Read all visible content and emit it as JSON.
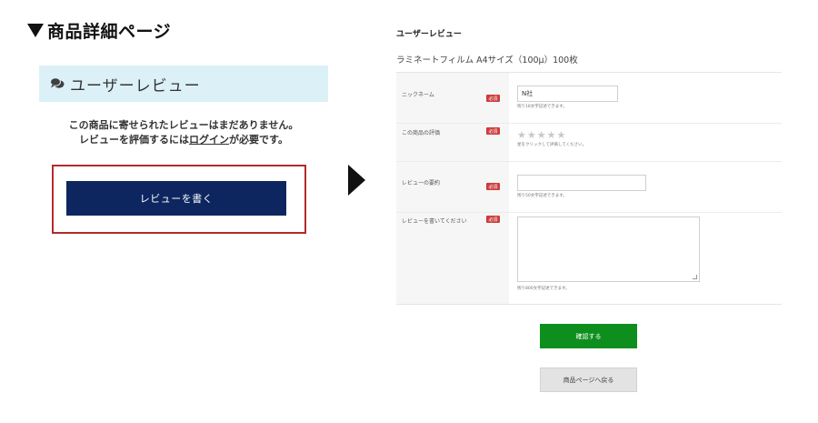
{
  "left_panel": {
    "heading": "商品詳細ページ",
    "review_section_title": "ユーザーレビュー",
    "no_review_line1": "この商品に寄せられたレビューはまだありません。",
    "no_review_line2_before": "レビューを評価するには",
    "login_link": "ログイン",
    "no_review_line2_after": "が必要です。",
    "write_review_button": "レビューを書く",
    "highlight_color": "#b42a2a",
    "button_color": "#0d2660"
  },
  "right_panel": {
    "title": "ユーザーレビュー",
    "product_name": "ラミネートフィルム A4サイズ（100μ）100枚",
    "required_badge": "必須",
    "fields": {
      "nickname": {
        "label": "ニックネーム",
        "value": "N社",
        "hint": "残り18文字記述できます。"
      },
      "rating": {
        "label": "この商品の評価",
        "hint": "星をクリックして評価してください。",
        "stars_total": 5,
        "stars_selected": 0
      },
      "summary": {
        "label": "レビューの要約",
        "value": "",
        "hint": "残り50文字記述できます。"
      },
      "body": {
        "label": "レビューを書いてください",
        "value": "",
        "hint": "残り800文字記述できます。"
      }
    },
    "confirm_button": "確認する",
    "back_button": "商品ページへ戻る",
    "required_color": "#cd3b3b",
    "confirm_color": "#0e8f1d"
  }
}
